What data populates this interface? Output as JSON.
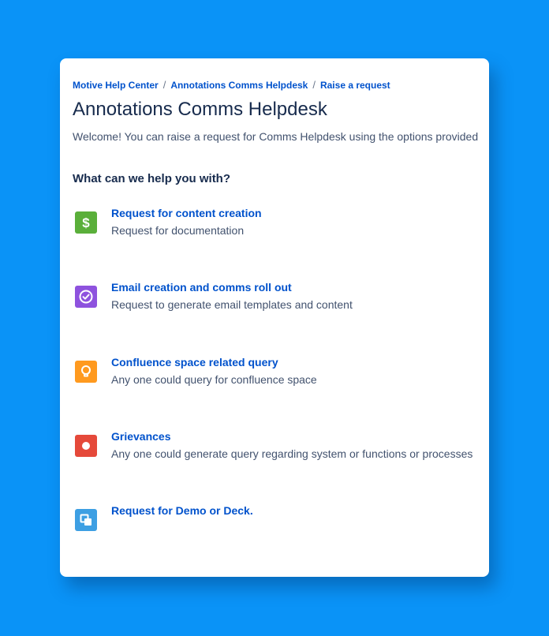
{
  "breadcrumb": {
    "items": [
      "Motive Help Center",
      "Annotations Comms Helpdesk",
      "Raise a request"
    ],
    "separator": "/"
  },
  "page": {
    "title": "Annotations Comms Helpdesk",
    "welcome": "Welcome! You can raise a request for Comms Helpdesk using the options provided"
  },
  "section": {
    "heading": "What can we help you with?"
  },
  "request_types": [
    {
      "title": "Request for content creation",
      "description": "Request for documentation",
      "icon": "dollar-icon",
      "color": "#5aaf3a"
    },
    {
      "title": "Email creation and comms roll out",
      "description": "Request to generate email templates and content",
      "icon": "check-circle-icon",
      "color": "#8e52de"
    },
    {
      "title": "Confluence space related query",
      "description": "Any one could query for confluence space",
      "icon": "lightbulb-icon",
      "color": "#ff9a1f"
    },
    {
      "title": "Grievances",
      "description": "Any one could generate query regarding system or functions or processes",
      "icon": "record-icon",
      "color": "#e5493a"
    },
    {
      "title": "Request for Demo or Deck.",
      "description": "",
      "icon": "copy-icon",
      "color": "#3d9fe3"
    }
  ],
  "colors": {
    "background": "#0a93f7",
    "link": "#0052cc",
    "heading": "#172b4d",
    "body_text": "#42526e"
  }
}
